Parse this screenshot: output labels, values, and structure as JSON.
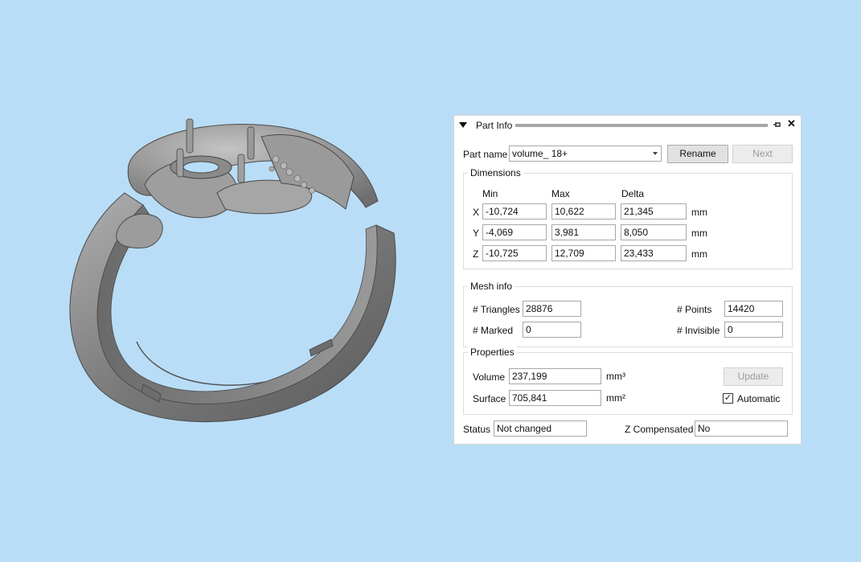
{
  "panel": {
    "title": "Part Info",
    "part_name_label": "Part name",
    "part_name_value": "volume_ 18+",
    "rename_label": "Rename",
    "next_label": "Next",
    "dimensions": {
      "title": "Dimensions",
      "col_min": "Min",
      "col_max": "Max",
      "col_delta": "Delta",
      "rows": [
        {
          "axis": "X",
          "min": "-10,724",
          "max": "10,622",
          "delta": "21,345",
          "unit": "mm"
        },
        {
          "axis": "Y",
          "min": "-4,069",
          "max": "3,981",
          "delta": "8,050",
          "unit": "mm"
        },
        {
          "axis": "Z",
          "min": "-10,725",
          "max": "12,709",
          "delta": "23,433",
          "unit": "mm"
        }
      ]
    },
    "mesh_info": {
      "title": "Mesh info",
      "triangles_label": "# Triangles",
      "triangles_value": "28876",
      "points_label": "# Points",
      "points_value": "14420",
      "marked_label": "# Marked",
      "marked_value": "0",
      "invisible_label": "# Invisible",
      "invisible_value": "0"
    },
    "properties": {
      "title": "Properties",
      "volume_label": "Volume",
      "volume_value": "237,199",
      "volume_unit": "mm³",
      "surface_label": "Surface",
      "surface_value": "705,841",
      "surface_unit": "mm²",
      "update_label": "Update",
      "automatic_label": "Automatic",
      "automatic_checked": "✓"
    },
    "status_label": "Status",
    "status_value": "Not changed",
    "z_comp_label": "Z Compensated",
    "z_comp_value": "No"
  },
  "colors": {
    "background": "#b9ddf7",
    "model": "#8c8c8c"
  },
  "icons": [
    "collapse-triangle-icon",
    "pin-icon",
    "close-icon",
    "combo-arrow-icon",
    "checkmark-icon"
  ]
}
